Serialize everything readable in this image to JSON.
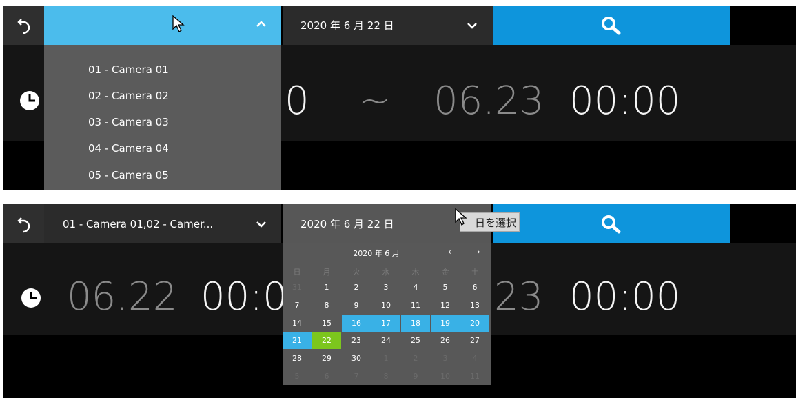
{
  "panel1": {
    "camera_dropdown": {
      "expanded": true,
      "options": [
        "01 - Camera 01",
        "02 - Camera 02",
        "03 - Camera 03",
        "04 - Camera 04",
        "05 - Camera 05"
      ]
    },
    "date_label": "2020 年 6 月 22 日",
    "time_range": {
      "start_time_fragment": "0",
      "separator": "~",
      "end_date": "06.23",
      "end_time": "00:00"
    }
  },
  "panel2": {
    "camera_label": "01 - Camera 01,02 - Camer...",
    "date_label": "2020 年 6 月 22 日",
    "tooltip": "日を選択",
    "time_range": {
      "start_date": "06.22",
      "start_time_fragment": "00:0",
      "end_date_fragment": "23",
      "end_time": "00:00"
    },
    "calendar": {
      "title": "2020 年 6 月",
      "weekdays": [
        "日",
        "月",
        "火",
        "水",
        "木",
        "金",
        "土"
      ],
      "weeks": [
        [
          "31",
          "1",
          "2",
          "3",
          "4",
          "5",
          "6"
        ],
        [
          "7",
          "8",
          "9",
          "10",
          "11",
          "12",
          "13"
        ],
        [
          "14",
          "15",
          "16",
          "17",
          "18",
          "19",
          "20"
        ],
        [
          "21",
          "22",
          "23",
          "24",
          "25",
          "26",
          "27"
        ],
        [
          "28",
          "29",
          "30",
          "1",
          "2",
          "3",
          "4"
        ],
        [
          "5",
          "6",
          "7",
          "8",
          "9",
          "10",
          "11"
        ]
      ],
      "selected_day": "22",
      "range_days": [
        "16",
        "17",
        "18",
        "19",
        "20",
        "21"
      ]
    }
  },
  "colors": {
    "accent": "#0e95dc",
    "dropdown_active": "#4bbcec",
    "range": "#39b1e6",
    "selected": "#7cc61d"
  }
}
